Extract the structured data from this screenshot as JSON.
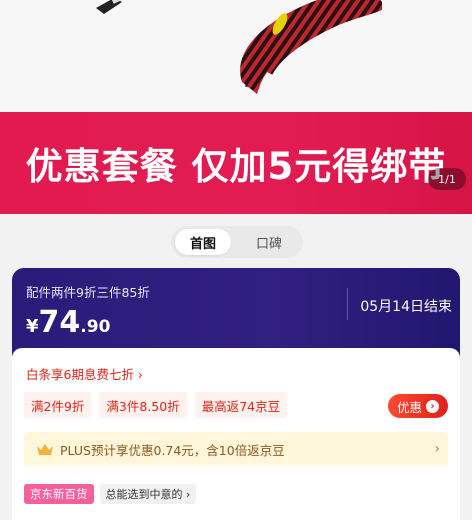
{
  "promo": {
    "text": "优惠套餐 仅加5元得绑带",
    "page_counter": "1/1"
  },
  "tabs": [
    {
      "label": "首图"
    },
    {
      "label": "口碑"
    }
  ],
  "price_card": {
    "subtitle": "配件两件9折三件85折",
    "currency": "¥",
    "price_int": "74",
    "price_dec": ".90",
    "end_date": "05月14日结束"
  },
  "info": {
    "baitiao": "白条享6期息费七折 ›",
    "chips": [
      "满2件9折",
      "满3件8.50折",
      "最高返74京豆"
    ],
    "coupon_label": "优惠",
    "plus_text": "PLUS预计享优惠0.74元，含10倍返京豆",
    "plus_chevron": "›",
    "badge": "京东新百货",
    "badge_link": "总能选到中意的 ›"
  },
  "colors": {
    "brand_red": "#e31a4f",
    "card_purple": "#2a1b7a"
  }
}
